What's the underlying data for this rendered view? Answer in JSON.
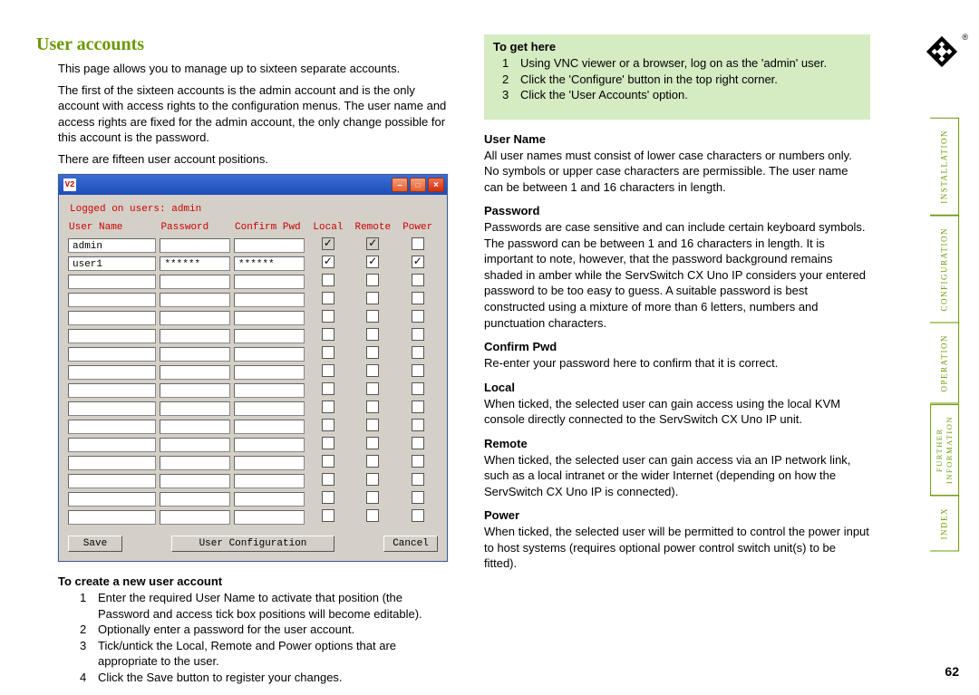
{
  "title": "User accounts",
  "intro": {
    "p1": "This page allows you to manage up to sixteen separate accounts.",
    "p2": "The first of the sixteen accounts is the admin account and is the only account with access rights to the configuration menus. The user name and access rights are fixed for the admin account, the only change possible for this account is the password.",
    "p3": "There are fifteen user account positions."
  },
  "window": {
    "vnc_label": "V2",
    "logged_on": "Logged on users: admin",
    "headers": {
      "user": "User Name",
      "password": "Password",
      "confirm": "Confirm Pwd",
      "local": "Local",
      "remote": "Remote",
      "power": "Power"
    },
    "rows": [
      {
        "user": "admin",
        "password": "",
        "confirm": "",
        "local": "checked-disabled",
        "remote": "checked-disabled",
        "power": ""
      },
      {
        "user": "user1",
        "password": "******",
        "confirm": "******",
        "local": "checked",
        "remote": "checked",
        "power": "checked"
      },
      {
        "user": "",
        "password": "",
        "confirm": "",
        "local": "",
        "remote": "",
        "power": ""
      },
      {
        "user": "",
        "password": "",
        "confirm": "",
        "local": "",
        "remote": "",
        "power": ""
      },
      {
        "user": "",
        "password": "",
        "confirm": "",
        "local": "",
        "remote": "",
        "power": ""
      },
      {
        "user": "",
        "password": "",
        "confirm": "",
        "local": "",
        "remote": "",
        "power": ""
      },
      {
        "user": "",
        "password": "",
        "confirm": "",
        "local": "",
        "remote": "",
        "power": ""
      },
      {
        "user": "",
        "password": "",
        "confirm": "",
        "local": "",
        "remote": "",
        "power": ""
      },
      {
        "user": "",
        "password": "",
        "confirm": "",
        "local": "",
        "remote": "",
        "power": ""
      },
      {
        "user": "",
        "password": "",
        "confirm": "",
        "local": "",
        "remote": "",
        "power": ""
      },
      {
        "user": "",
        "password": "",
        "confirm": "",
        "local": "",
        "remote": "",
        "power": ""
      },
      {
        "user": "",
        "password": "",
        "confirm": "",
        "local": "",
        "remote": "",
        "power": ""
      },
      {
        "user": "",
        "password": "",
        "confirm": "",
        "local": "",
        "remote": "",
        "power": ""
      },
      {
        "user": "",
        "password": "",
        "confirm": "",
        "local": "",
        "remote": "",
        "power": ""
      },
      {
        "user": "",
        "password": "",
        "confirm": "",
        "local": "",
        "remote": "",
        "power": ""
      },
      {
        "user": "",
        "password": "",
        "confirm": "",
        "local": "",
        "remote": "",
        "power": ""
      }
    ],
    "buttons": {
      "save": "Save",
      "title": "User Configuration",
      "cancel": "Cancel"
    }
  },
  "create": {
    "heading": "To create a new user account",
    "steps": [
      "Enter the required User Name to activate that position (the Password and access tick box positions will become editable).",
      "Optionally enter a password for the user account.",
      "Tick/untick the Local, Remote and Power options that are appropriate to the user.",
      "Click the Save button to register your changes."
    ]
  },
  "to_get_here": {
    "heading": "To get here",
    "steps": [
      "Using VNC viewer or a browser, log on as the 'admin' user.",
      "Click the 'Configure' button in the top right corner.",
      "Click the 'User Accounts' option."
    ]
  },
  "fields": [
    {
      "h": "User Name",
      "b": "All user names must consist of lower case characters or numbers only. No symbols or upper case characters are permissible. The user name can be between 1 and 16 characters in length."
    },
    {
      "h": "Password",
      "b": "Passwords are case sensitive and can include certain keyboard symbols. The password can be between 1 and 16 characters in length. It is important to note, however, that the password background remains shaded in amber while the ServSwitch CX Uno IP considers your entered password to be too easy to guess. A suitable password is best constructed using a mixture of more than 6 letters, numbers and punctuation characters."
    },
    {
      "h": "Confirm Pwd",
      "b": "Re-enter your password here to confirm that it is correct."
    },
    {
      "h": "Local",
      "b": "When ticked, the selected user can gain access using the local KVM console directly connected to the ServSwitch CX Uno IP unit."
    },
    {
      "h": "Remote",
      "b": "When ticked, the selected user can gain access via an IP network link, such as a local intranet or the wider Internet (depending on how the ServSwitch CX Uno IP is connected)."
    },
    {
      "h": "Power",
      "b": "When ticked, the selected user will be permitted to control the power input to host systems (requires optional power control switch unit(s) to be fitted)."
    }
  ],
  "tabs": [
    "INSTALLATION",
    "CONFIGURATION",
    "OPERATION",
    "FURTHER\nINFORMATION",
    "INDEX"
  ],
  "page_num": "62",
  "reg": "®"
}
